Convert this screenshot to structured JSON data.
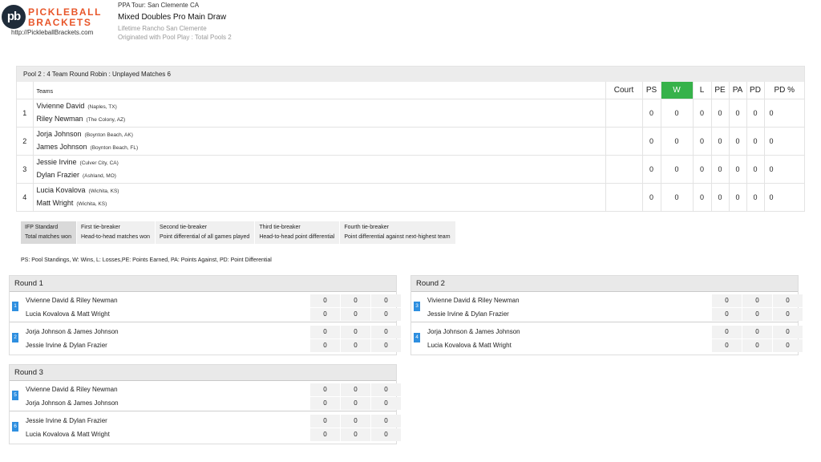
{
  "brand": {
    "mark": "pb",
    "word1": "PICKLEBALL",
    "word2": "BRACKETS",
    "url": "http://PickleballBrackets.com"
  },
  "header": {
    "tour": "PPA Tour: San Clemente CA",
    "event": "Mixed Doubles Pro Main Draw",
    "venue": "Lifetime Rancho San Clemente",
    "origin": "Originated with Pool Play : Total Pools 2"
  },
  "pool": {
    "title": "Pool 2 : 4 Team Round Robin : Unplayed Matches",
    "unplayed": "6",
    "columns": {
      "teams": "Teams",
      "court": "Court",
      "ps": "PS",
      "w": "W",
      "l": "L",
      "pe": "PE",
      "pa": "PA",
      "pd": "PD",
      "pdp": "PD %"
    },
    "rows": [
      {
        "rank": "1",
        "p1": "Vivienne David",
        "c1": "(Naples, TX)",
        "p2": "Riley Newman",
        "c2": "(The Colony, AZ)",
        "court": "",
        "ps": "0",
        "w": "0",
        "l": "0",
        "pe": "0",
        "pa": "0",
        "pd": "0",
        "pdp": "0"
      },
      {
        "rank": "2",
        "p1": "Jorja Johnson",
        "c1": "(Boynton Beach, AK)",
        "p2": "James Johnson",
        "c2": "(Boynton Beach, FL)",
        "court": "",
        "ps": "0",
        "w": "0",
        "l": "0",
        "pe": "0",
        "pa": "0",
        "pd": "0",
        "pdp": "0"
      },
      {
        "rank": "3",
        "p1": "Jessie Irvine",
        "c1": "(Culver City, CA)",
        "p2": "Dylan Frazier",
        "c2": "(Ashland, MO)",
        "court": "",
        "ps": "0",
        "w": "0",
        "l": "0",
        "pe": "0",
        "pa": "0",
        "pd": "0",
        "pdp": "0"
      },
      {
        "rank": "4",
        "p1": "Lucia Kovalova",
        "c1": "(Wichita, KS)",
        "p2": "Matt Wright",
        "c2": "(Wichita, KS)",
        "court": "",
        "ps": "0",
        "w": "0",
        "l": "0",
        "pe": "0",
        "pa": "0",
        "pd": "0",
        "pdp": "0"
      }
    ]
  },
  "tiebreakers": [
    {
      "title": "IFP Standard",
      "desc": "Total matches won"
    },
    {
      "title": "First tie-breaker",
      "desc": "Head-to-head matches won"
    },
    {
      "title": "Second tie-breaker",
      "desc": "Point differential of all games played"
    },
    {
      "title": "Third tie-breaker",
      "desc": "Head-to-head point differential"
    },
    {
      "title": "Fourth tie-breaker",
      "desc": "Point differential against next-highest team"
    }
  ],
  "legend": "PS: Pool Standings, W: Wins, L: Losses,PE: Points Earned, PA: Points Against, PD: Point Differential",
  "rounds": [
    {
      "title": "Round 1",
      "matches": [
        {
          "num": "1",
          "a": "Vivienne David & Riley Newman",
          "b": "Lucia Kovalova & Matt Wright",
          "sa": [
            "0",
            "0",
            "0"
          ],
          "sb": [
            "0",
            "0",
            "0"
          ]
        },
        {
          "num": "2",
          "a": "Jorja Johnson & James Johnson",
          "b": "Jessie Irvine & Dylan Frazier",
          "sa": [
            "0",
            "0",
            "0"
          ],
          "sb": [
            "0",
            "0",
            "0"
          ]
        }
      ]
    },
    {
      "title": "Round 2",
      "matches": [
        {
          "num": "3",
          "a": "Vivienne David & Riley Newman",
          "b": "Jessie Irvine & Dylan Frazier",
          "sa": [
            "0",
            "0",
            "0"
          ],
          "sb": [
            "0",
            "0",
            "0"
          ]
        },
        {
          "num": "4",
          "a": "Jorja Johnson & James Johnson",
          "b": "Lucia Kovalova & Matt Wright",
          "sa": [
            "0",
            "0",
            "0"
          ],
          "sb": [
            "0",
            "0",
            "0"
          ]
        }
      ]
    },
    {
      "title": "Round 3",
      "matches": [
        {
          "num": "5",
          "a": "Vivienne David & Riley Newman",
          "b": "Jorja Johnson & James Johnson",
          "sa": [
            "0",
            "0",
            "0"
          ],
          "sb": [
            "0",
            "0",
            "0"
          ]
        },
        {
          "num": "6",
          "a": "Jessie Irvine & Dylan Frazier",
          "b": "Lucia Kovalova & Matt Wright",
          "sa": [
            "0",
            "0",
            "0"
          ],
          "sb": [
            "0",
            "0",
            "0"
          ]
        }
      ]
    }
  ],
  "colors": {
    "brand_orange": "#e8562a",
    "wins_header": "#36b24a",
    "match_badge": "#2e8fe0"
  }
}
